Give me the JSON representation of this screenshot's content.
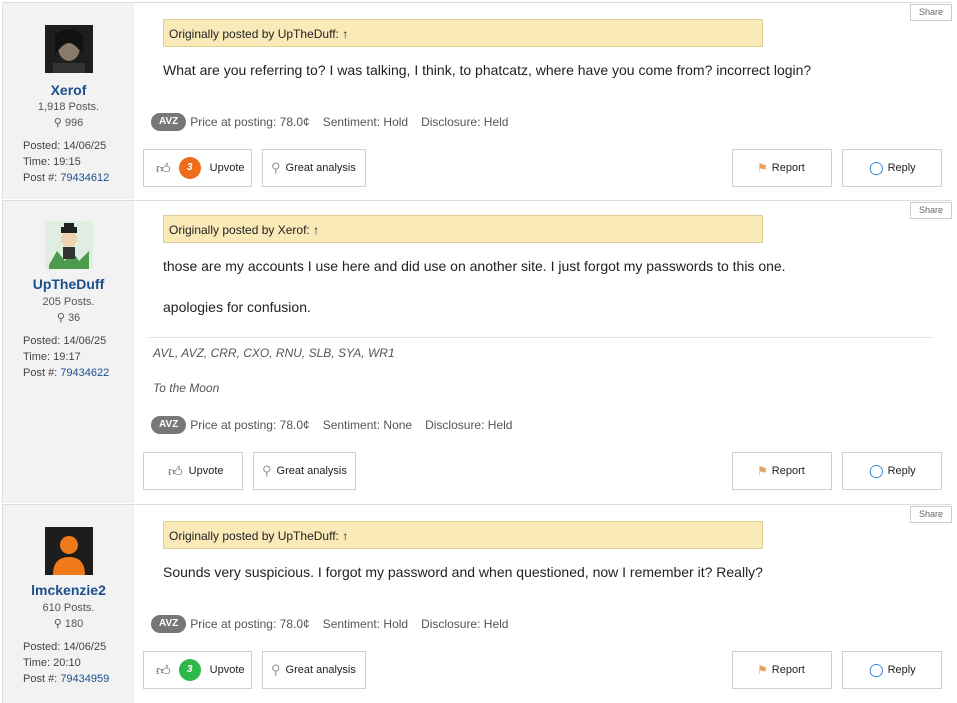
{
  "ui": {
    "share_label": "Share",
    "upvote_label": "Upvote",
    "great_label": "Great analysis",
    "report_label": "Report",
    "reply_label": "Reply",
    "price_label": "Price at posting:",
    "sentiment_label": "Sentiment:",
    "disclosure_label": "Disclosure:",
    "posted_label": "Posted:",
    "time_label": "Time:",
    "post_num_label": "Post #:"
  },
  "posts": [
    {
      "username": "Xerof",
      "posts_count": "1,918 Posts.",
      "likes": "996",
      "posted": "14/06/25",
      "time": "19:15",
      "post_number": "79434612",
      "quote": "Originally posted by UpTheDuff: ↑",
      "body": [
        "What are you referring to? I was talking, I think, to phatcatz, where have you come from? incorrect login?"
      ],
      "ticker": "AVZ",
      "price": "78.0¢",
      "sentiment": "Hold",
      "disclosure": "Held",
      "upvotes": "3",
      "upvote_color": "#ef6c1a"
    },
    {
      "username": "UpTheDuff",
      "posts_count": "205 Posts.",
      "likes": "36",
      "posted": "14/06/25",
      "time": "19:17",
      "post_number": "79434622",
      "quote": "Originally posted by Xerof: ↑",
      "body": [
        "those are my accounts I use here and did use on another site. I just forgot my passwords to this one.",
        "apologies for confusion."
      ],
      "stocks": "AVL, AVZ, CRR, CXO, RNU, SLB, SYA, WR1",
      "signature": "To the Moon",
      "ticker": "AVZ",
      "price": "78.0¢",
      "sentiment": "None",
      "disclosure": "Held"
    },
    {
      "username": "lmckenzie2",
      "posts_count": "610 Posts.",
      "likes": "180",
      "posted": "14/06/25",
      "time": "20:10",
      "post_number": "79434959",
      "quote": "Originally posted by UpTheDuff: ↑",
      "body": [
        "Sounds very suspicious. I forgot my password and when questioned, now I remember it? Really?"
      ],
      "ticker": "AVZ",
      "price": "78.0¢",
      "sentiment": "Hold",
      "disclosure": "Held",
      "upvotes": "3",
      "upvote_color": "#2db84b"
    }
  ]
}
